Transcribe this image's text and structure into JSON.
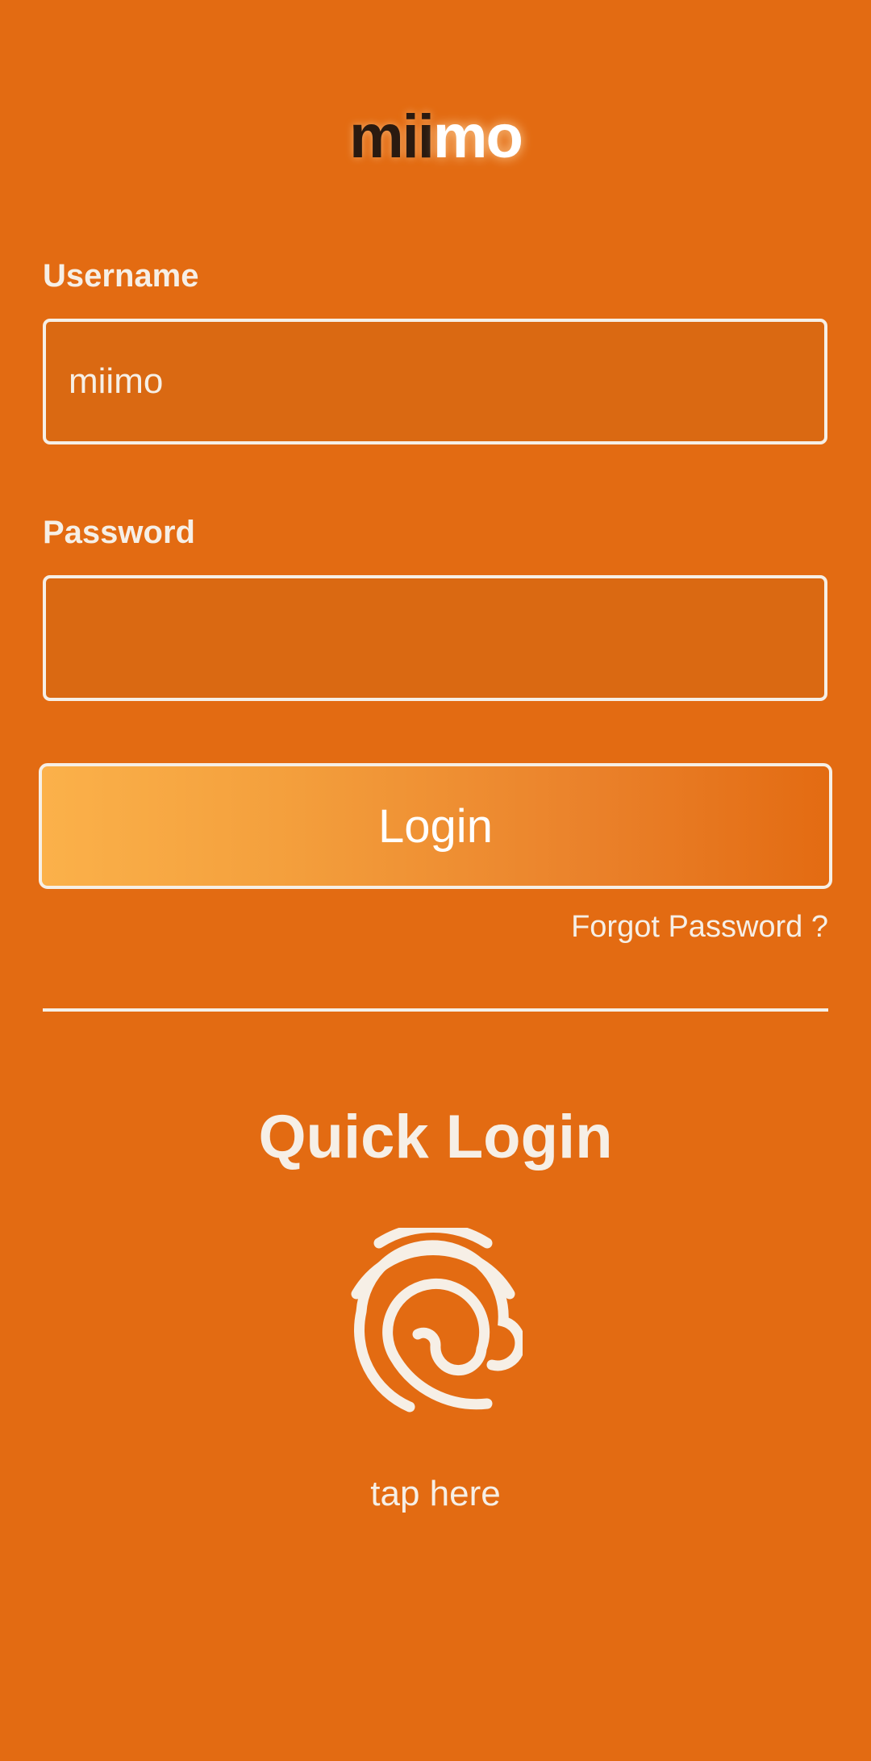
{
  "logo": {
    "part_dark": "mii",
    "part_light": "mo"
  },
  "username": {
    "label": "Username",
    "value": "miimo"
  },
  "password": {
    "label": "Password",
    "value": ""
  },
  "login_button": "Login",
  "forgot_password": "Forgot Password ?",
  "quick_login": {
    "title": "Quick Login",
    "icon": "fingerprint-icon",
    "hint": "tap here"
  },
  "colors": {
    "background": "#e36b12",
    "field_fill": "#da6912",
    "foreground": "#f6efe6",
    "button_gradient_start": "#fbb14a"
  }
}
